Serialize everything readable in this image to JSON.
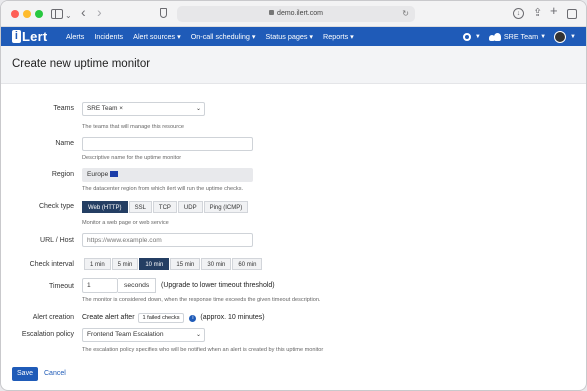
{
  "browser": {
    "url": "demo.ilert.com"
  },
  "nav": {
    "logo": "iLert",
    "items": [
      "Alerts",
      "Incidents",
      "Alert sources ▾",
      "On-call scheduling ▾",
      "Status pages ▾",
      "Reports ▾"
    ],
    "team_label": "SRE Team"
  },
  "page": {
    "title": "Create new uptime monitor"
  },
  "form": {
    "teams": {
      "label": "Teams",
      "tag": "SRE Team",
      "help": "The teams that will manage this resource"
    },
    "name": {
      "label": "Name",
      "value": "",
      "help": "Descriptive name for the uptime monitor"
    },
    "region": {
      "label": "Region",
      "value": "Europe",
      "help": "The datacenter region from which ilert will run the uptime checks."
    },
    "check_type": {
      "label": "Check type",
      "options": [
        "Web (HTTP)",
        "SSL",
        "TCP",
        "UDP",
        "Ping (ICMP)"
      ],
      "selected": "Web (HTTP)",
      "help": "Monitor a web page or web service"
    },
    "url_host": {
      "label": "URL / Host",
      "placeholder": "https://www.example.com"
    },
    "check_interval": {
      "label": "Check interval",
      "options": [
        "1 min",
        "5 min",
        "10 min",
        "15 min",
        "30 min",
        "60 min"
      ],
      "selected": "10 min"
    },
    "timeout": {
      "label": "Timeout",
      "value": "1",
      "unit": "seconds",
      "upgrade_link": "(Upgrade to lower timeout threshold)",
      "help": "The monitor is considered down, when the response time exceeds the given timeout description."
    },
    "alert_creation": {
      "label": "Alert creation",
      "prefix": "Create alert after",
      "pill": "1 failed checks",
      "info": "i",
      "suffix": "(approx. 10 minutes)"
    },
    "escalation_policy": {
      "label": "Escalation policy",
      "value": "Frontend Team Escalation",
      "help": "The escalation policy specifies who will be notified when an alert is created by this uptime monitor"
    }
  },
  "actions": {
    "save": "Save",
    "cancel": "Cancel"
  },
  "colors": {
    "brand": "#1f5bb8",
    "active_segment": "#243e63"
  }
}
